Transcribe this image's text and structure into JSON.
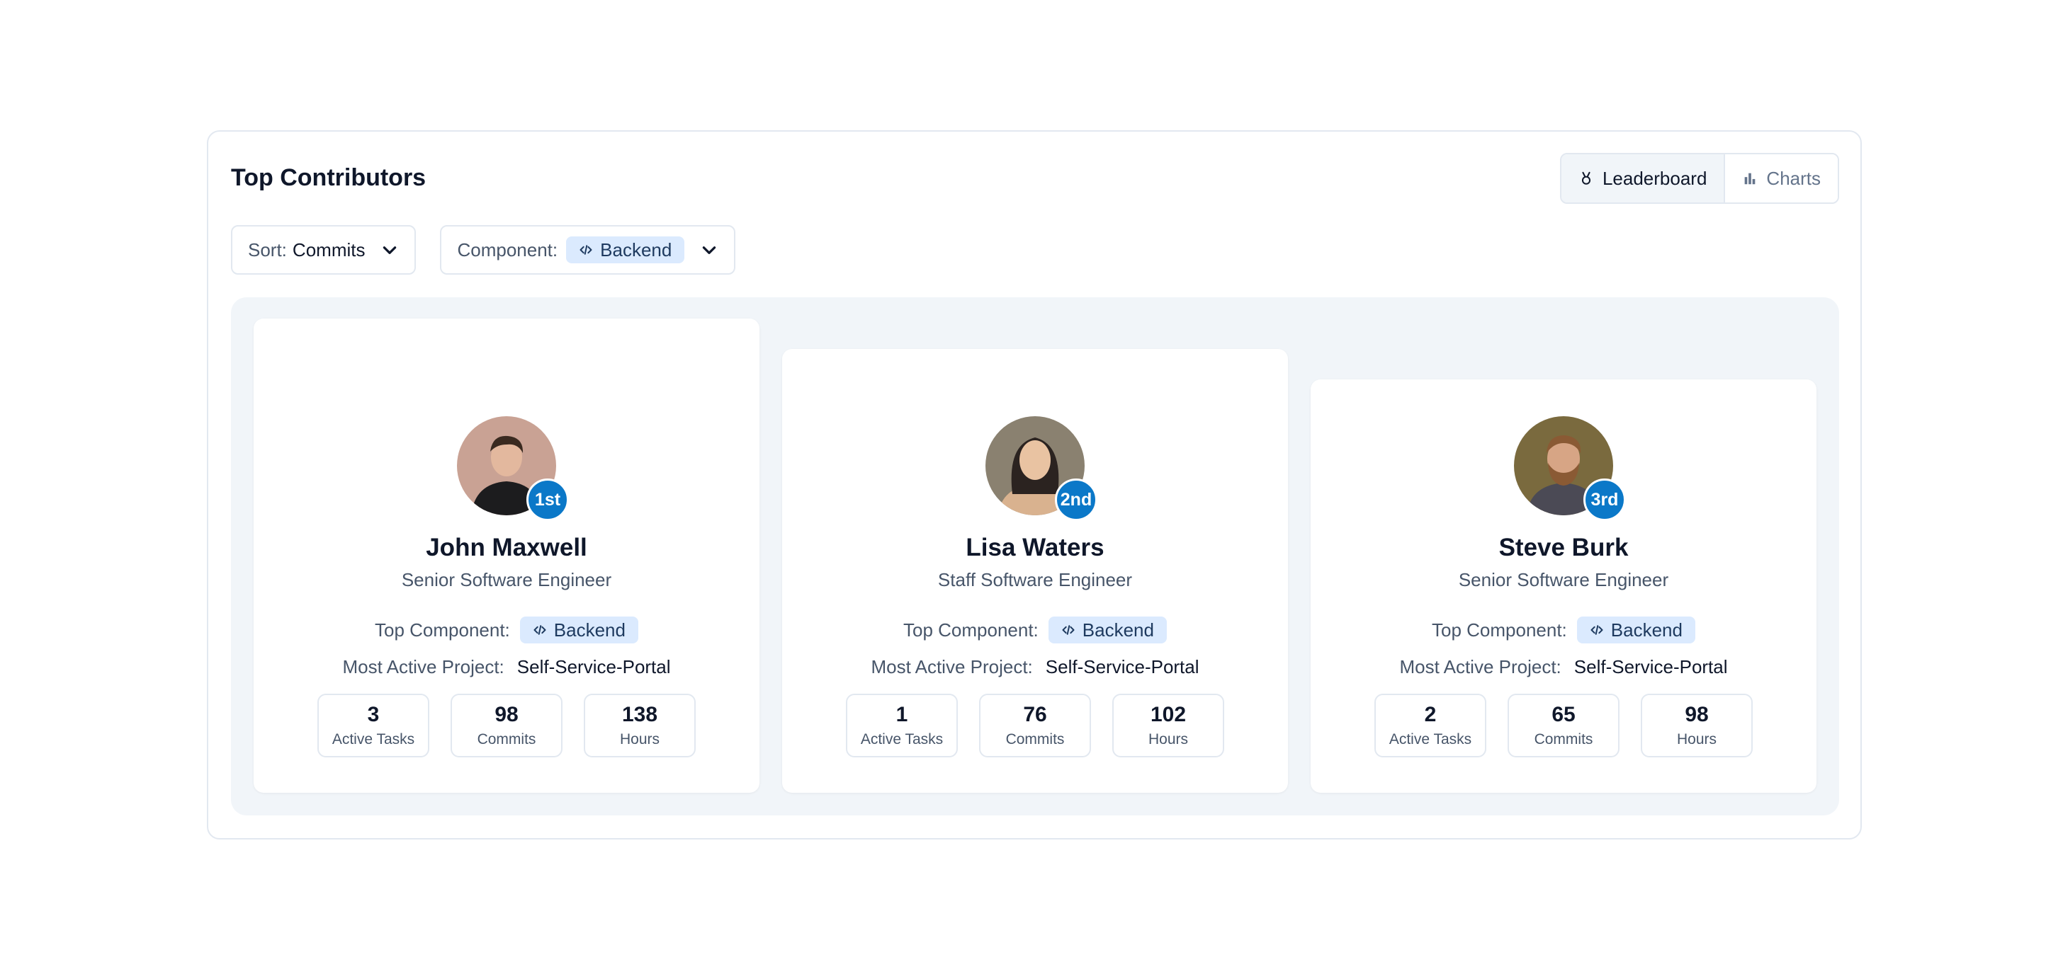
{
  "panel": {
    "title": "Top Contributors",
    "views": {
      "leaderboard_label": "Leaderboard",
      "charts_label": "Charts",
      "active": "Leaderboard"
    }
  },
  "filters": {
    "sort": {
      "label": "Sort:",
      "value": "Commits"
    },
    "component": {
      "label": "Component:",
      "value": "Backend"
    }
  },
  "labels": {
    "top_component": "Top Component:",
    "most_active_project": "Most Active Project:",
    "active_tasks": "Active Tasks",
    "commits": "Commits",
    "hours": "Hours"
  },
  "contributors": [
    {
      "rank": "1st",
      "name": "John Maxwell",
      "role": "Senior Software Engineer",
      "top_component": "Backend",
      "project": "Self-Service-Portal",
      "active_tasks": "3",
      "commits": "98",
      "hours": "138"
    },
    {
      "rank": "2nd",
      "name": "Lisa Waters",
      "role": "Staff Software Engineer",
      "top_component": "Backend",
      "project": "Self-Service-Portal",
      "active_tasks": "1",
      "commits": "76",
      "hours": "102"
    },
    {
      "rank": "3rd",
      "name": "Steve Burk",
      "role": "Senior Software Engineer",
      "top_component": "Backend",
      "project": "Self-Service-Portal",
      "active_tasks": "2",
      "commits": "65",
      "hours": "98"
    }
  ],
  "colors": {
    "rank_badge": "#0b78c8",
    "chip_bg": "#dbeafe",
    "podium_bg": "#f1f5f9"
  }
}
